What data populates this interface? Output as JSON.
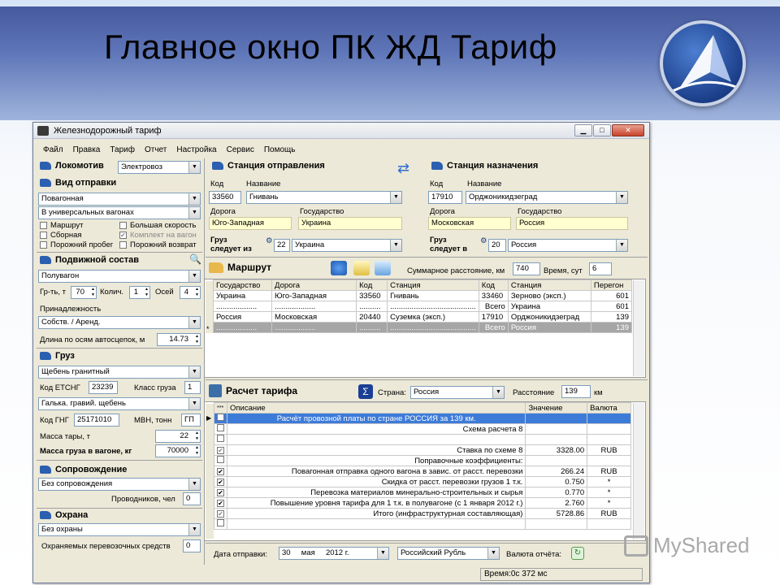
{
  "slide": {
    "title": "Главное окно ПК ЖД Тариф",
    "watermark": "MyShared"
  },
  "window": {
    "title": "Железнодорожный тариф",
    "menu": [
      "Файл",
      "Правка",
      "Тариф",
      "Отчет",
      "Настройка",
      "Сервис",
      "Помощь"
    ]
  },
  "left": {
    "locomotive": {
      "label": "Локомотив",
      "value": "Электровоз"
    },
    "shipment": {
      "label": "Вид отправки",
      "type": "Повагонная",
      "wagons": "В универсальных вагонах",
      "checks": [
        {
          "label": "Маршрут",
          "checked": false
        },
        {
          "label": "Большая скорость",
          "checked": false
        },
        {
          "label": "Сборная",
          "checked": false
        },
        {
          "label": "Комплект на вагон",
          "checked": true
        },
        {
          "label": "Порожний пробег",
          "checked": false
        },
        {
          "label": "Порожний возврат",
          "checked": false
        }
      ]
    },
    "rolling": {
      "label": "Подвижной состав",
      "value": "Полувагон",
      "axle_group_label": "Гр-ть, т",
      "axle_group": "70",
      "count_label": "Колич.",
      "count": "1",
      "axles_label": "Осей",
      "axles": "4",
      "owner_label": "Принадлежность",
      "owner": "Собств. / Аренд.",
      "length_label": "Длина по осям автосцепок, м",
      "length": "14.73"
    },
    "cargo": {
      "label": "Груз",
      "value": "Щебень гранитный",
      "etsng_label": "Код ЕТСНГ",
      "etsng": "23239",
      "class_label": "Класс груза",
      "class": "1",
      "gng_name": "Галька. гравий. щебень",
      "gng_label": "Код ГНГ",
      "gng": "25171010",
      "mvn_label": "МВН, тонн",
      "mvn": "ГП",
      "tare_label": "Масса тары, т",
      "tare": "22",
      "mass_label": "Масса груза в вагоне, кг",
      "mass": "70000"
    },
    "escort": {
      "label": "Сопровождение",
      "value": "Без сопровождения",
      "guides_label": "Проводников, чел",
      "guides": "0"
    },
    "guard": {
      "label": "Охрана",
      "value": "Без охраны",
      "means_label": "Охраняемых перевозочных средств",
      "means": "0"
    }
  },
  "departure": {
    "label": "Станция отправления",
    "code_label": "Код",
    "name_label": "Название",
    "code": "33560",
    "name": "Гнивань",
    "road_label": "Дорога",
    "state_label": "Государство",
    "road": "Юго-Западная",
    "state": "Украина",
    "via_label": "Груз следует из",
    "via_code": "22",
    "via_country": "Украина"
  },
  "arrival": {
    "label": "Станция назначения",
    "code_label": "Код",
    "name_label": "Название",
    "code": "17910",
    "name": "Орджоникидзеград",
    "road_label": "Дорога",
    "state_label": "Государство",
    "road": "Московская",
    "state": "Россия",
    "via_label": "Груз следует в",
    "via_code": "20",
    "via_country": "Россия"
  },
  "route": {
    "label": "Маршрут",
    "distance_label": "Суммарное расстояние, км",
    "distance": "740",
    "time_label": "Время, сут",
    "time": "6",
    "headers": [
      "Государство",
      "Дорога",
      "Код",
      "Станция",
      "Код",
      "Станция",
      "Перегон"
    ],
    "rows": [
      [
        "Украина",
        "Юго-Западная",
        "33560",
        "Гнивань",
        "33460",
        "Зерново (эксп.)",
        "601"
      ],
      [
        "...................",
        "...................",
        "..........",
        "........................................",
        "Всего",
        "Украина",
        "601"
      ],
      [
        "Россия",
        "Московская",
        "20440",
        "Суземка (эксп.)",
        "17910",
        "Орджоникидзеград",
        "139"
      ],
      [
        "...................",
        "...................",
        "..........",
        "........................................",
        "Всего",
        "Россия",
        "139"
      ]
    ]
  },
  "tariff": {
    "label": "Расчет тарифа",
    "country_label": "Страна:",
    "country": "Россия",
    "distance_label": "Расстояние",
    "distance": "139",
    "unit": "км",
    "headers": [
      "***",
      "Описание",
      "Значение",
      "Валюта"
    ],
    "rows": [
      {
        "chk": "",
        "desc": "Расчёт провозной платы по стране РОССИЯ за 139 км.",
        "val": "",
        "cur": ""
      },
      {
        "chk": "",
        "desc": "Схема расчета 8",
        "val": "",
        "cur": ""
      },
      {
        "chk": "",
        "desc": "",
        "val": "",
        "cur": ""
      },
      {
        "chk": "✔",
        "desc": "Ставка по схеме 8",
        "val": "3328.00",
        "cur": "RUB"
      },
      {
        "chk": "",
        "desc": "Поправочные коэффициенты:",
        "val": "",
        "cur": ""
      },
      {
        "chk": "✔",
        "desc": "Повагонная отправка одного вагона в завис. от расст. перевозки",
        "val": "266.24",
        "cur": "RUB"
      },
      {
        "chk": "✔",
        "desc": "Скидка от расст. перевозки грузов 1 т.к.",
        "val": "0.750",
        "cur": "*"
      },
      {
        "chk": "✔",
        "desc": "Перевозка материалов минерально-строительных и сырья",
        "val": "0.770",
        "cur": "*"
      },
      {
        "chk": "✔",
        "desc": "Повышение уровня тарифа для 1 т.к. в полувагоне (с 1 января 2012 г.)",
        "val": "2.760",
        "cur": "*"
      },
      {
        "chk": "✔",
        "desc": "Итого (инфраструктурная составляющая)",
        "val": "5728.86",
        "cur": "RUB"
      },
      {
        "chk": "",
        "desc": "",
        "val": "",
        "cur": ""
      }
    ]
  },
  "footer": {
    "date_label": "Дата отправки:",
    "day": "30",
    "month": "мая",
    "year": "2012 г.",
    "currency": "Российский Рубль",
    "report_label": "Валюта отчёта:"
  },
  "status": {
    "text": "Время:0с 372 мс"
  }
}
